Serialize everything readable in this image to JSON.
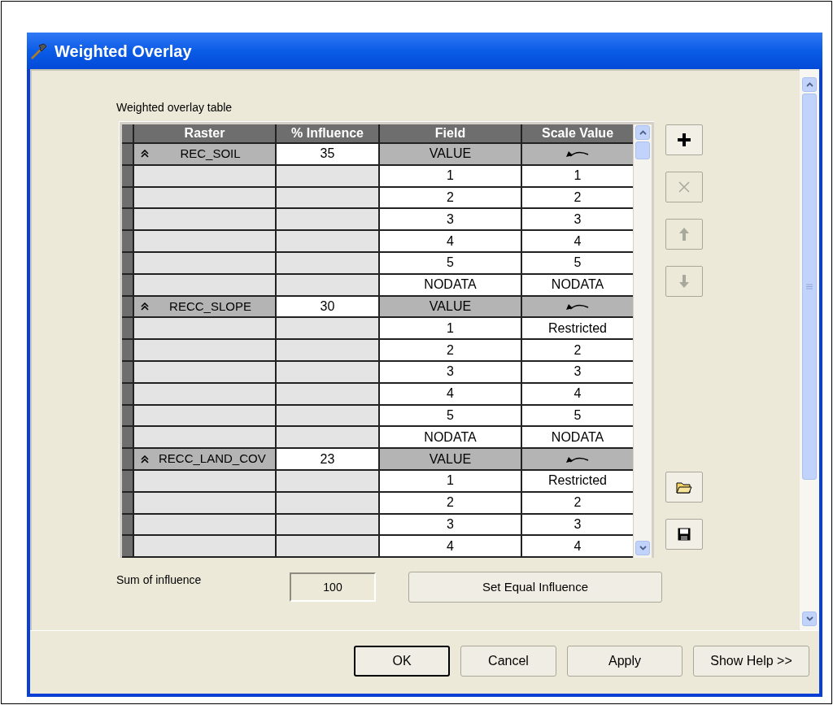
{
  "window": {
    "title": "Weighted Overlay"
  },
  "table_label": "Weighted overlay table",
  "table": {
    "columns": [
      "Raster",
      "% Influence",
      "Field",
      "Scale Value"
    ],
    "rasters": [
      {
        "name": "REC_SOIL",
        "influence": "35",
        "field": "VALUE",
        "expanded": true,
        "rows": [
          {
            "field": "1",
            "scale": "1"
          },
          {
            "field": "2",
            "scale": "2"
          },
          {
            "field": "3",
            "scale": "3"
          },
          {
            "field": "4",
            "scale": "4"
          },
          {
            "field": "5",
            "scale": "5"
          },
          {
            "field": "NODATA",
            "scale": "NODATA"
          }
        ]
      },
      {
        "name": "RECC_SLOPE",
        "influence": "30",
        "field": "VALUE",
        "expanded": true,
        "rows": [
          {
            "field": "1",
            "scale": "Restricted"
          },
          {
            "field": "2",
            "scale": "2"
          },
          {
            "field": "3",
            "scale": "3"
          },
          {
            "field": "4",
            "scale": "4"
          },
          {
            "field": "5",
            "scale": "5"
          },
          {
            "field": "NODATA",
            "scale": "NODATA"
          }
        ]
      },
      {
        "name": "RECC_LAND_COV",
        "influence": "23",
        "field": "VALUE",
        "expanded": true,
        "rows": [
          {
            "field": "1",
            "scale": "Restricted"
          },
          {
            "field": "2",
            "scale": "2"
          },
          {
            "field": "3",
            "scale": "3"
          },
          {
            "field": "4",
            "scale": "4"
          }
        ]
      }
    ]
  },
  "side_buttons": [
    {
      "kind": "add",
      "disabled": false
    },
    {
      "kind": "remove",
      "disabled": true
    },
    {
      "kind": "up",
      "disabled": true
    },
    {
      "kind": "down",
      "disabled": true
    },
    {
      "kind": "open",
      "disabled": false
    },
    {
      "kind": "save",
      "disabled": false
    }
  ],
  "sum": {
    "label": "Sum of influence",
    "value": "100"
  },
  "equal_button": "Set Equal Influence",
  "buttons": [
    {
      "label": "OK",
      "default": true
    },
    {
      "label": "Cancel",
      "default": false
    },
    {
      "label": "Apply",
      "default": false
    },
    {
      "label": "Show Help >>",
      "default": false
    }
  ]
}
